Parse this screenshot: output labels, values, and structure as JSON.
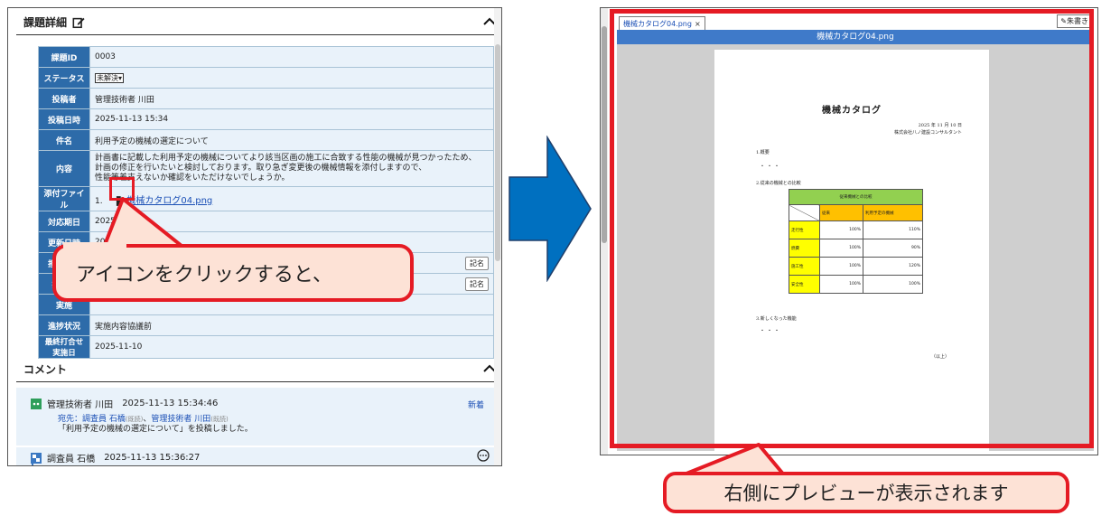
{
  "left": {
    "detail_title": "課題詳細",
    "rows": [
      {
        "label": "課題ID",
        "value": "0003"
      },
      {
        "label": "ステータス",
        "value": "未解決"
      },
      {
        "label": "投稿者",
        "value": "管理技術者 川田"
      },
      {
        "label": "投稿日時",
        "value": "2025-11-13 15:34"
      },
      {
        "label": "件名",
        "value": "利用予定の機械の選定について"
      },
      {
        "label": "内容",
        "lines": [
          "計画書に記載した利用予定の機械についてより該当区画の施工に合致する性能の機械が見つかったため、",
          "計画の修正を行いたいと検討しております。取り急ぎ変更後の機械情報を添付しますので、",
          "性能等差支えないか確認をいただけないでしょうか。"
        ]
      },
      {
        "label": "添付ファイル",
        "prefix": "1.",
        "value": "機械カタログ04.png"
      },
      {
        "label": "対応期日",
        "value": "2025-11-30"
      },
      {
        "label": "更新日時",
        "value": "2025-11"
      },
      {
        "label": "担当者（",
        "button": "記名"
      },
      {
        "label": "担当者",
        "button": "記名"
      },
      {
        "label": "実施",
        "value": ""
      },
      {
        "label": "進捗状況",
        "value": "実施内容協議前"
      },
      {
        "label": "最終打合せ実施日",
        "value": "2025-11-10"
      }
    ],
    "comment_title": "コメント",
    "comments": [
      {
        "author": "管理技術者 川田",
        "time": "2025-11-13 15:34:46",
        "badge": "新着",
        "to_label": "宛先：",
        "to1": "調査員 石橋",
        "to1_state": "(既読)",
        "sep": "、",
        "to2": "管理技術者 川田",
        "to2_state": "(既読)",
        "body": "「利用予定の機械の選定について」を投稿しました。"
      },
      {
        "author": "調査員 石橋",
        "time": "2025-11-13 15:36:27"
      }
    ],
    "callout": "アイコンをクリックすると、"
  },
  "right": {
    "tab_label": "機械カタログ04.png",
    "tab_close": "×",
    "edit_label": "朱書き",
    "viewer_title": "機械カタログ04.png",
    "doc": {
      "title": "機械カタログ",
      "date": "2025 年 11 月 10 日",
      "company": "株式会社八ノ建設コンサルタント",
      "h1": "1.概要",
      "dots1": "・・・",
      "h2": "2.従来の機械との比較",
      "table_head": "従来機械との比較",
      "col1": "従来",
      "col2": "利用予定の機械",
      "table_rows": [
        {
          "name": "走行性",
          "a": "100%",
          "b": "110%"
        },
        {
          "name": "燃費",
          "a": "100%",
          "b": "90%"
        },
        {
          "name": "施工性",
          "a": "100%",
          "b": "120%"
        },
        {
          "name": "安全性",
          "a": "100%",
          "b": "100%"
        }
      ],
      "h3": "3.新しくなった機能",
      "dots3": "・・・",
      "end": "（以上）"
    },
    "callout": "右側にプレビューが表示されます"
  },
  "colors": {
    "header_blue": "#2d6ba9",
    "cell_bg": "#e9f2fa",
    "accent_red": "#e51b24",
    "callout_bg": "#fde2d6",
    "arrow": "#0070c0"
  }
}
